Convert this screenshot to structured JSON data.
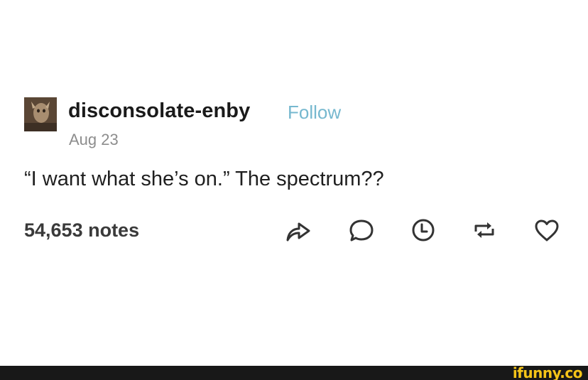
{
  "post": {
    "username": "disconsolate-enby",
    "follow_label": "Follow",
    "date": "Aug 23",
    "body": "“I want what she’s on.” The spectrum??",
    "notes": "54,653 notes",
    "actions": {
      "share": "share-icon",
      "reply": "reply-icon",
      "schedule": "clock-icon",
      "reblog": "reblog-icon",
      "like": "heart-icon"
    }
  },
  "colors": {
    "follow": "#76b8cf",
    "text": "#1f1f1f",
    "muted": "#8d8d8d",
    "footer": "#181818",
    "watermark": "#f5c418"
  },
  "footer": {
    "watermark": "ifunny.co"
  }
}
